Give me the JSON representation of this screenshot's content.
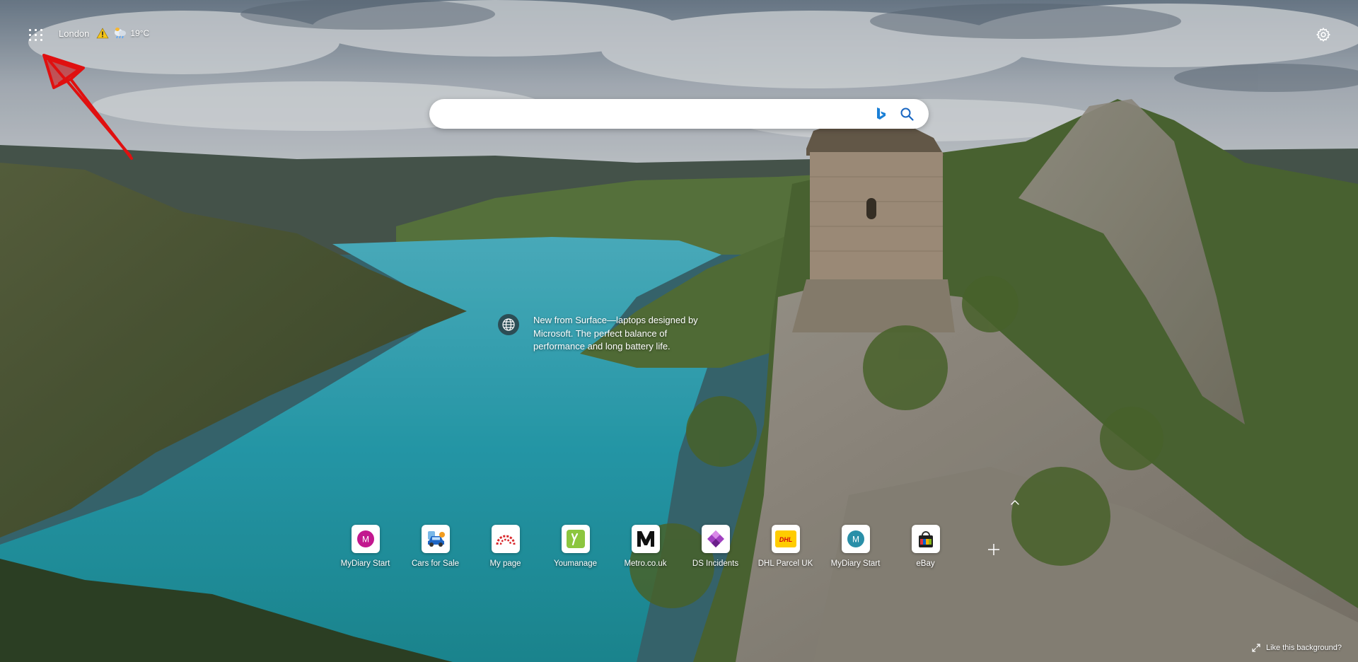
{
  "topbar": {
    "city": "London",
    "temperature": "19°C"
  },
  "search": {
    "placeholder": "",
    "value": ""
  },
  "promo": {
    "text": "New from Surface—laptops designed by Microsoft. The perfect balance of performance and long battery life."
  },
  "quick_links": [
    {
      "label": "MyDiary Start",
      "icon": "letter-m-magenta",
      "glyph": "M",
      "color": "#c2188f"
    },
    {
      "label": "Cars for Sale",
      "icon": "car-icon"
    },
    {
      "label": "My page",
      "icon": "rainbow-icon"
    },
    {
      "label": "Youmanage",
      "icon": "youmanage-icon",
      "color": "#8cc63f"
    },
    {
      "label": "Metro.co.uk",
      "icon": "metro-logo-icon"
    },
    {
      "label": "DS Incidents",
      "icon": "diamond-icon",
      "color": "#a040c0"
    },
    {
      "label": "DHL Parcel UK",
      "icon": "dhl-logo-icon",
      "color": "#ffcc00"
    },
    {
      "label": "MyDiary Start",
      "icon": "letter-m-teal",
      "glyph": "M",
      "color": "#2a8fa8"
    },
    {
      "label": "eBay",
      "icon": "shopping-bag-icon"
    }
  ],
  "footer": {
    "like_background": "Like this background?"
  },
  "colors": {
    "water": "#2aa5b5",
    "annotation": "#e01010"
  }
}
